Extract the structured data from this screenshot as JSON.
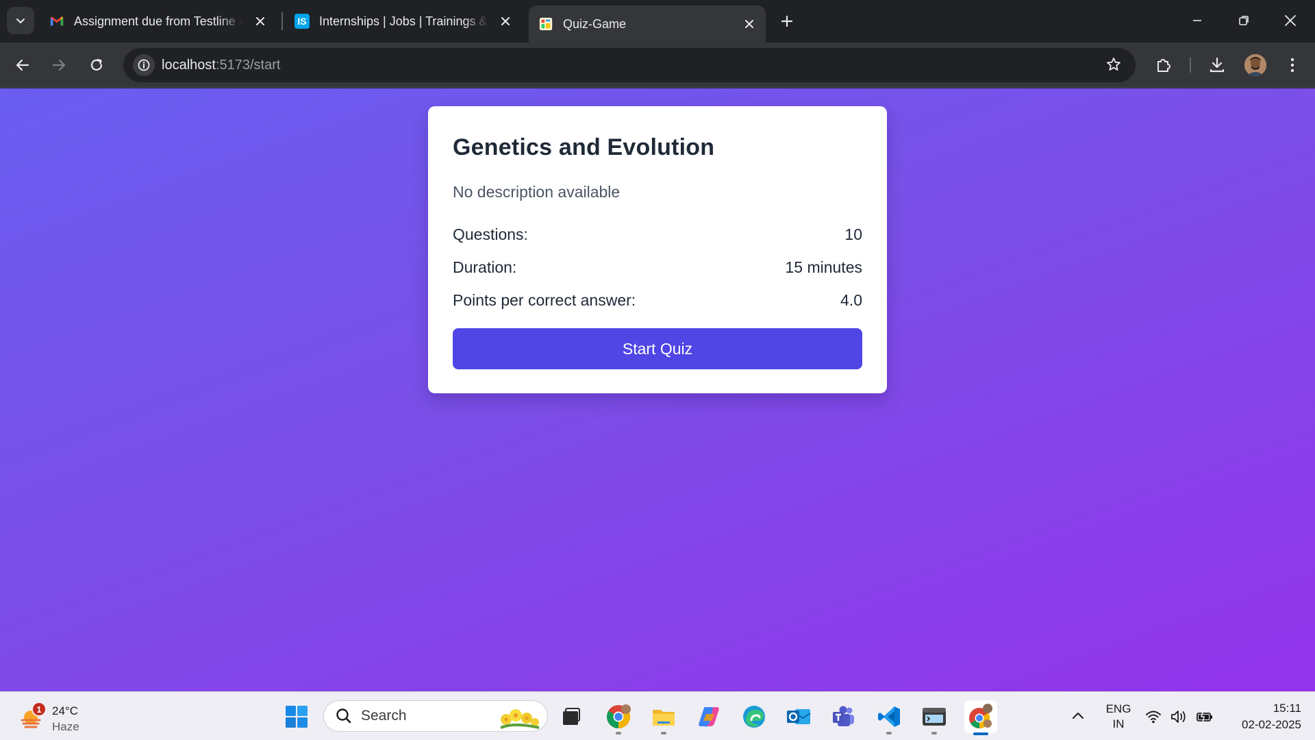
{
  "browser": {
    "tabs": [
      {
        "title": "Assignment due from Testline -",
        "icon": "gmail-icon",
        "active": false
      },
      {
        "title": "Internships | Jobs | Trainings & |",
        "icon": "internshala-icon",
        "active": false
      },
      {
        "title": "Quiz-Game",
        "icon": "quiz-game-icon",
        "active": true
      }
    ],
    "address": {
      "host": "localhost",
      "path": ":5173/start"
    }
  },
  "quiz": {
    "title": "Genetics and Evolution",
    "description": "No description available",
    "stats": [
      {
        "label": "Questions:",
        "value": "10"
      },
      {
        "label": "Duration:",
        "value": "15 minutes"
      },
      {
        "label": "Points per correct answer:",
        "value": "4.0"
      }
    ],
    "start_label": "Start Quiz",
    "button_color": "#4f46e5",
    "background_gradient": [
      "#6a5df0",
      "#9333ea"
    ]
  },
  "taskbar": {
    "weather": {
      "temp": "24°C",
      "condition": "Haze",
      "badge": "1"
    },
    "search_placeholder": "Search",
    "apps": [
      "start-icon",
      "search",
      "task-view-icon",
      "chrome-icon",
      "file-explorer-icon",
      "copilot-icon",
      "edge-icon",
      "outlook-icon",
      "teams-icon",
      "vscode-icon",
      "terminal-icon",
      "chrome-profile-icon"
    ],
    "language": {
      "line1": "ENG",
      "line2": "IN"
    },
    "time": "15:11",
    "date": "02-02-2025"
  }
}
